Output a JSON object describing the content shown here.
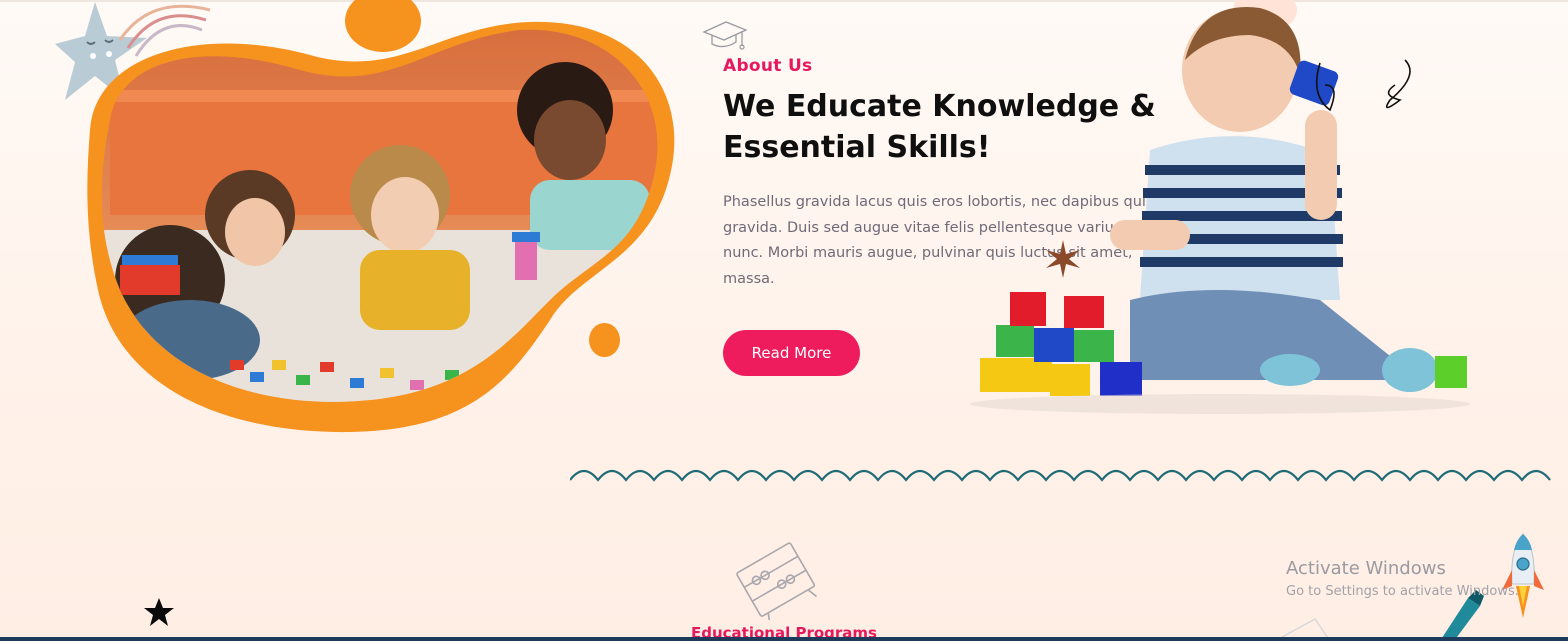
{
  "about": {
    "label": "About Us",
    "heading": "We Educate Knowledge & Essential Skills!",
    "paragraph": "Phasellus gravida lacus quis eros lobortis, nec dapibus quis gravida. Duis sed augue vitae felis pellentesque varius nunc. Morbi mauris augue, pulvinar quis luctus sit amet, massa.",
    "button_label": "Read More"
  },
  "programs": {
    "label": "Educational Programs"
  },
  "watermark": {
    "title": "Activate Windows",
    "subtitle": "Go to Settings to activate Windows."
  },
  "colors": {
    "accent_pink": "#ee1c5c",
    "blob_orange": "#f6921e",
    "wave_teal": "#1f6b78"
  },
  "icons": {
    "graduation_cap": "graduation-cap-icon",
    "abacus": "abacus-icon",
    "star": "star-icon",
    "rocket": "rocket-icon"
  }
}
